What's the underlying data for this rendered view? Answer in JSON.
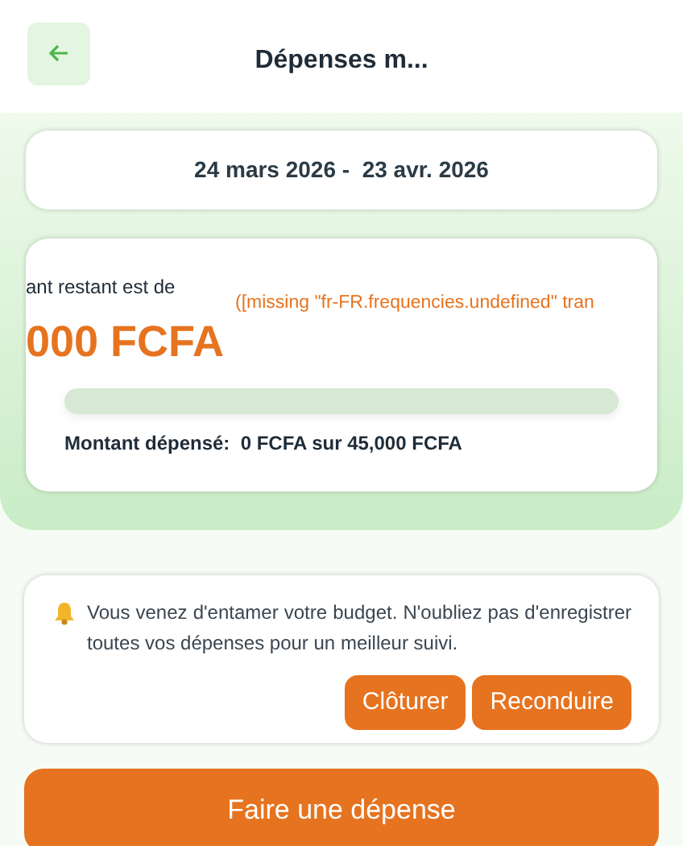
{
  "header": {
    "title": "Dépenses m..."
  },
  "period": {
    "text": "24 mars 2026 -  23 avr. 2026"
  },
  "budget": {
    "remaining_label": "ant restant est de",
    "remaining_amount": "000 FCFA",
    "frequency": "([missing \"fr-FR.frequencies.undefined\" tran",
    "level": 0,
    "spent": "Montant dépensé:  0 FCFA sur 45,000 FCFA"
  },
  "notice": {
    "text": "Vous venez d'entamer votre budget. N'oubliez pas d'enregistrer toutes vos dépenses pour un meilleur suivi.",
    "buttons": [
      "Clôturer",
      "Reconduire"
    ]
  },
  "primary_button": "Faire une dépense"
}
